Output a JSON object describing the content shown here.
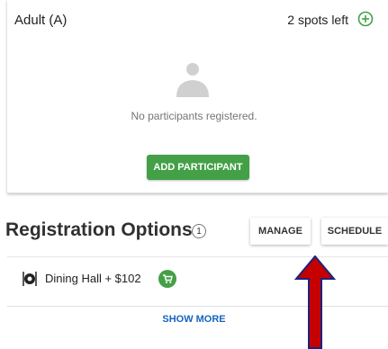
{
  "participants": {
    "category": "Adult (A)",
    "spots_left": "2 spots left",
    "empty_message": "No participants registered.",
    "add_participant_label": "ADD PARTICIPANT"
  },
  "registration_options": {
    "title": "Registration Options",
    "count": "1",
    "manage_label": "MANAGE",
    "schedule_label": "SCHEDULE",
    "items": [
      {
        "label": "Dining Hall + $102",
        "icon": "dining-icon",
        "action_icon": "cart-icon"
      }
    ],
    "show_more_label": "SHOW MORE"
  },
  "colors": {
    "accent_green": "#43a047",
    "link_blue": "#1565c0",
    "arrow_red": "#c40000",
    "arrow_outline": "#1a237e"
  }
}
